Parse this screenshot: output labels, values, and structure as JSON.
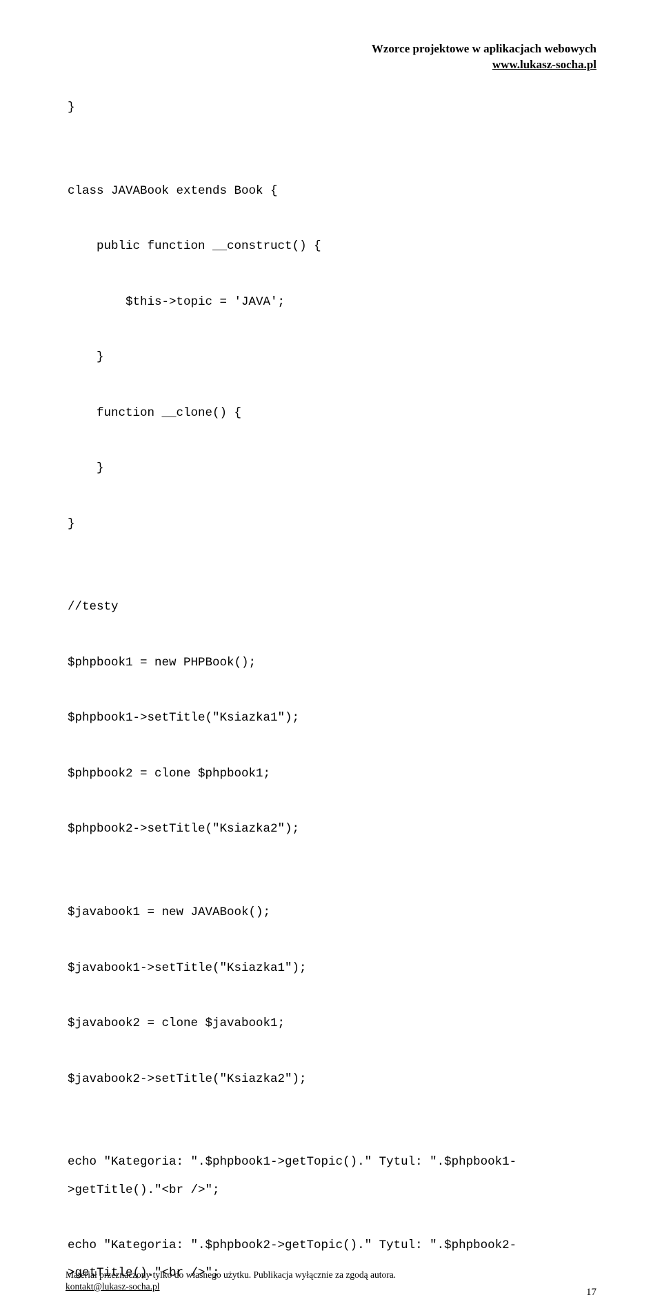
{
  "header": {
    "title": "Wzorce projektowe w aplikacjach webowych",
    "url": "www.lukasz-socha.pl"
  },
  "code": "}\n\n\nclass JAVABook extends Book {\n\n    public function __construct() {\n\n        $this->topic = 'JAVA';\n\n    }\n\n    function __clone() {\n\n    }\n\n}\n\n\n//testy\n\n$phpbook1 = new PHPBook();\n\n$phpbook1->setTitle(\"Ksiazka1\");\n\n$phpbook2 = clone $phpbook1;\n\n$phpbook2->setTitle(\"Ksiazka2\");\n\n\n$javabook1 = new JAVABook();\n\n$javabook1->setTitle(\"Ksiazka1\");\n\n$javabook2 = clone $javabook1;\n\n$javabook2->setTitle(\"Ksiazka2\");\n\n\necho \"Kategoria: \".$phpbook1->getTopic().\" Tytul: \".$phpbook1->getTitle().\"<br />\";\n\necho \"Kategoria: \".$phpbook2->getTopic().\" Tytul: \".$phpbook2->getTitle().\"<br />\";",
  "footer": {
    "line1": "Materiał przeznaczony tylko do własnego użytku. Publikacja wyłącznie za zgodą autora.",
    "line2": "kontakt@lukasz-socha.pl"
  },
  "page_number": "17"
}
